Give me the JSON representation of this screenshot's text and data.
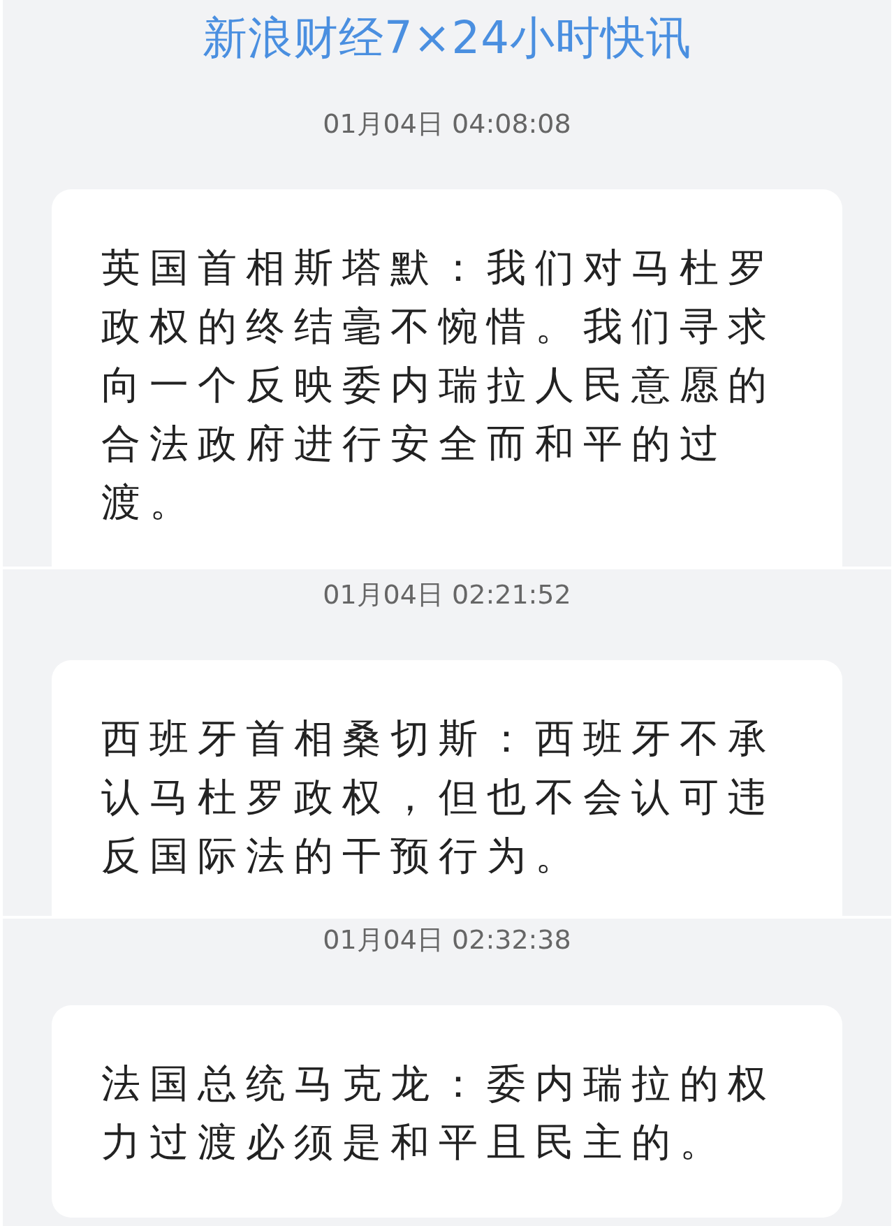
{
  "title": "新浪财经7×24小时快讯",
  "items": [
    {
      "time": "01月04日 04:08:08",
      "text": "英国首相斯塔默：我们对马杜罗政权的终结毫不惋惜。我们寻求向一个反映委内瑞拉人民意愿的合法政府进行安全而和平的过渡。"
    },
    {
      "time": "01月04日 02:21:52",
      "text": "西班牙首相桑切斯：西班牙不承认马杜罗政权，但也不会认可违反国际法的干预行为。"
    },
    {
      "time": "01月04日 02:32:38",
      "text": "法国总统马克龙：委内瑞拉的权力过渡必须是和平且民主的。"
    }
  ]
}
